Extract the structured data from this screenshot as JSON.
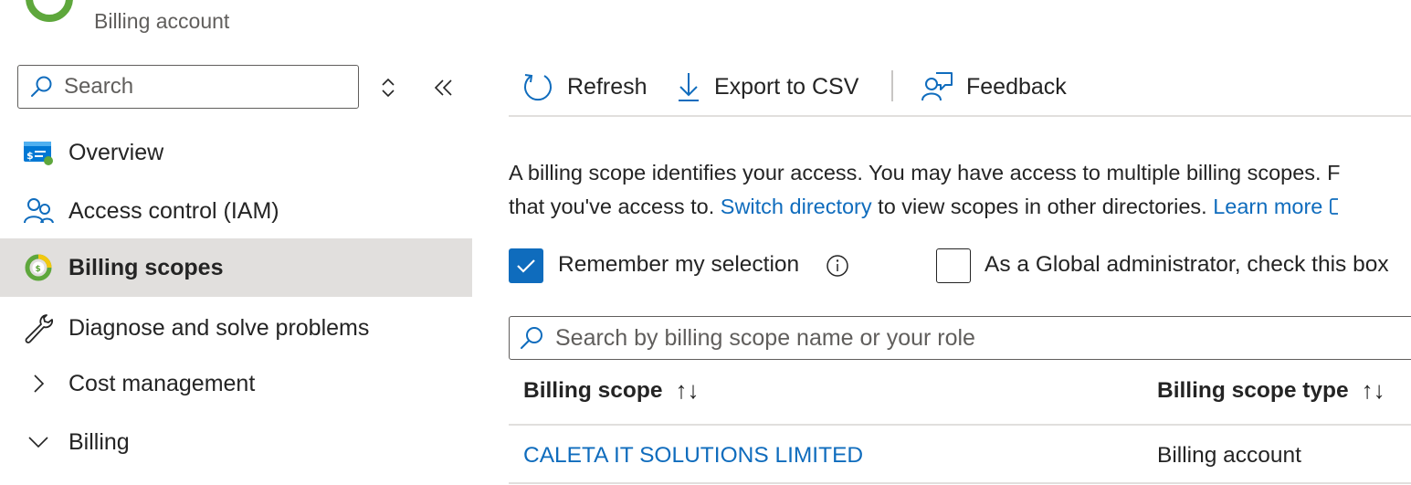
{
  "header": {
    "subtitle": "Billing account"
  },
  "sidebar": {
    "search_placeholder": "Search",
    "items": [
      {
        "label": "Overview"
      },
      {
        "label": "Access control (IAM)"
      },
      {
        "label": "Billing scopes"
      },
      {
        "label": "Diagnose and solve problems"
      },
      {
        "label": "Cost management"
      },
      {
        "label": "Billing"
      }
    ]
  },
  "toolbar": {
    "refresh": "Refresh",
    "export": "Export to CSV",
    "feedback": "Feedback"
  },
  "description": {
    "line1": "A billing scope identifies your access. You may have access to multiple billing scopes. F",
    "line2_prefix": "that you've access to. ",
    "switch_link": "Switch directory",
    "line2_mid": " to view scopes in other directories. ",
    "learn_link": "Learn more"
  },
  "options": {
    "remember": {
      "label": "Remember my selection",
      "checked": true
    },
    "global_admin": {
      "label": "As a Global administrator, check this box",
      "checked": false
    }
  },
  "table_search_placeholder": "Search by billing scope name or your role",
  "table": {
    "columns": [
      "Billing scope",
      "Billing scope type"
    ],
    "rows": [
      {
        "scope": "CALETA IT SOLUTIONS LIMITED",
        "type": "Billing account"
      }
    ]
  },
  "colors": {
    "accent": "#0f6cbd",
    "selected_bg": "#e1dfdd",
    "text": "#242424"
  }
}
